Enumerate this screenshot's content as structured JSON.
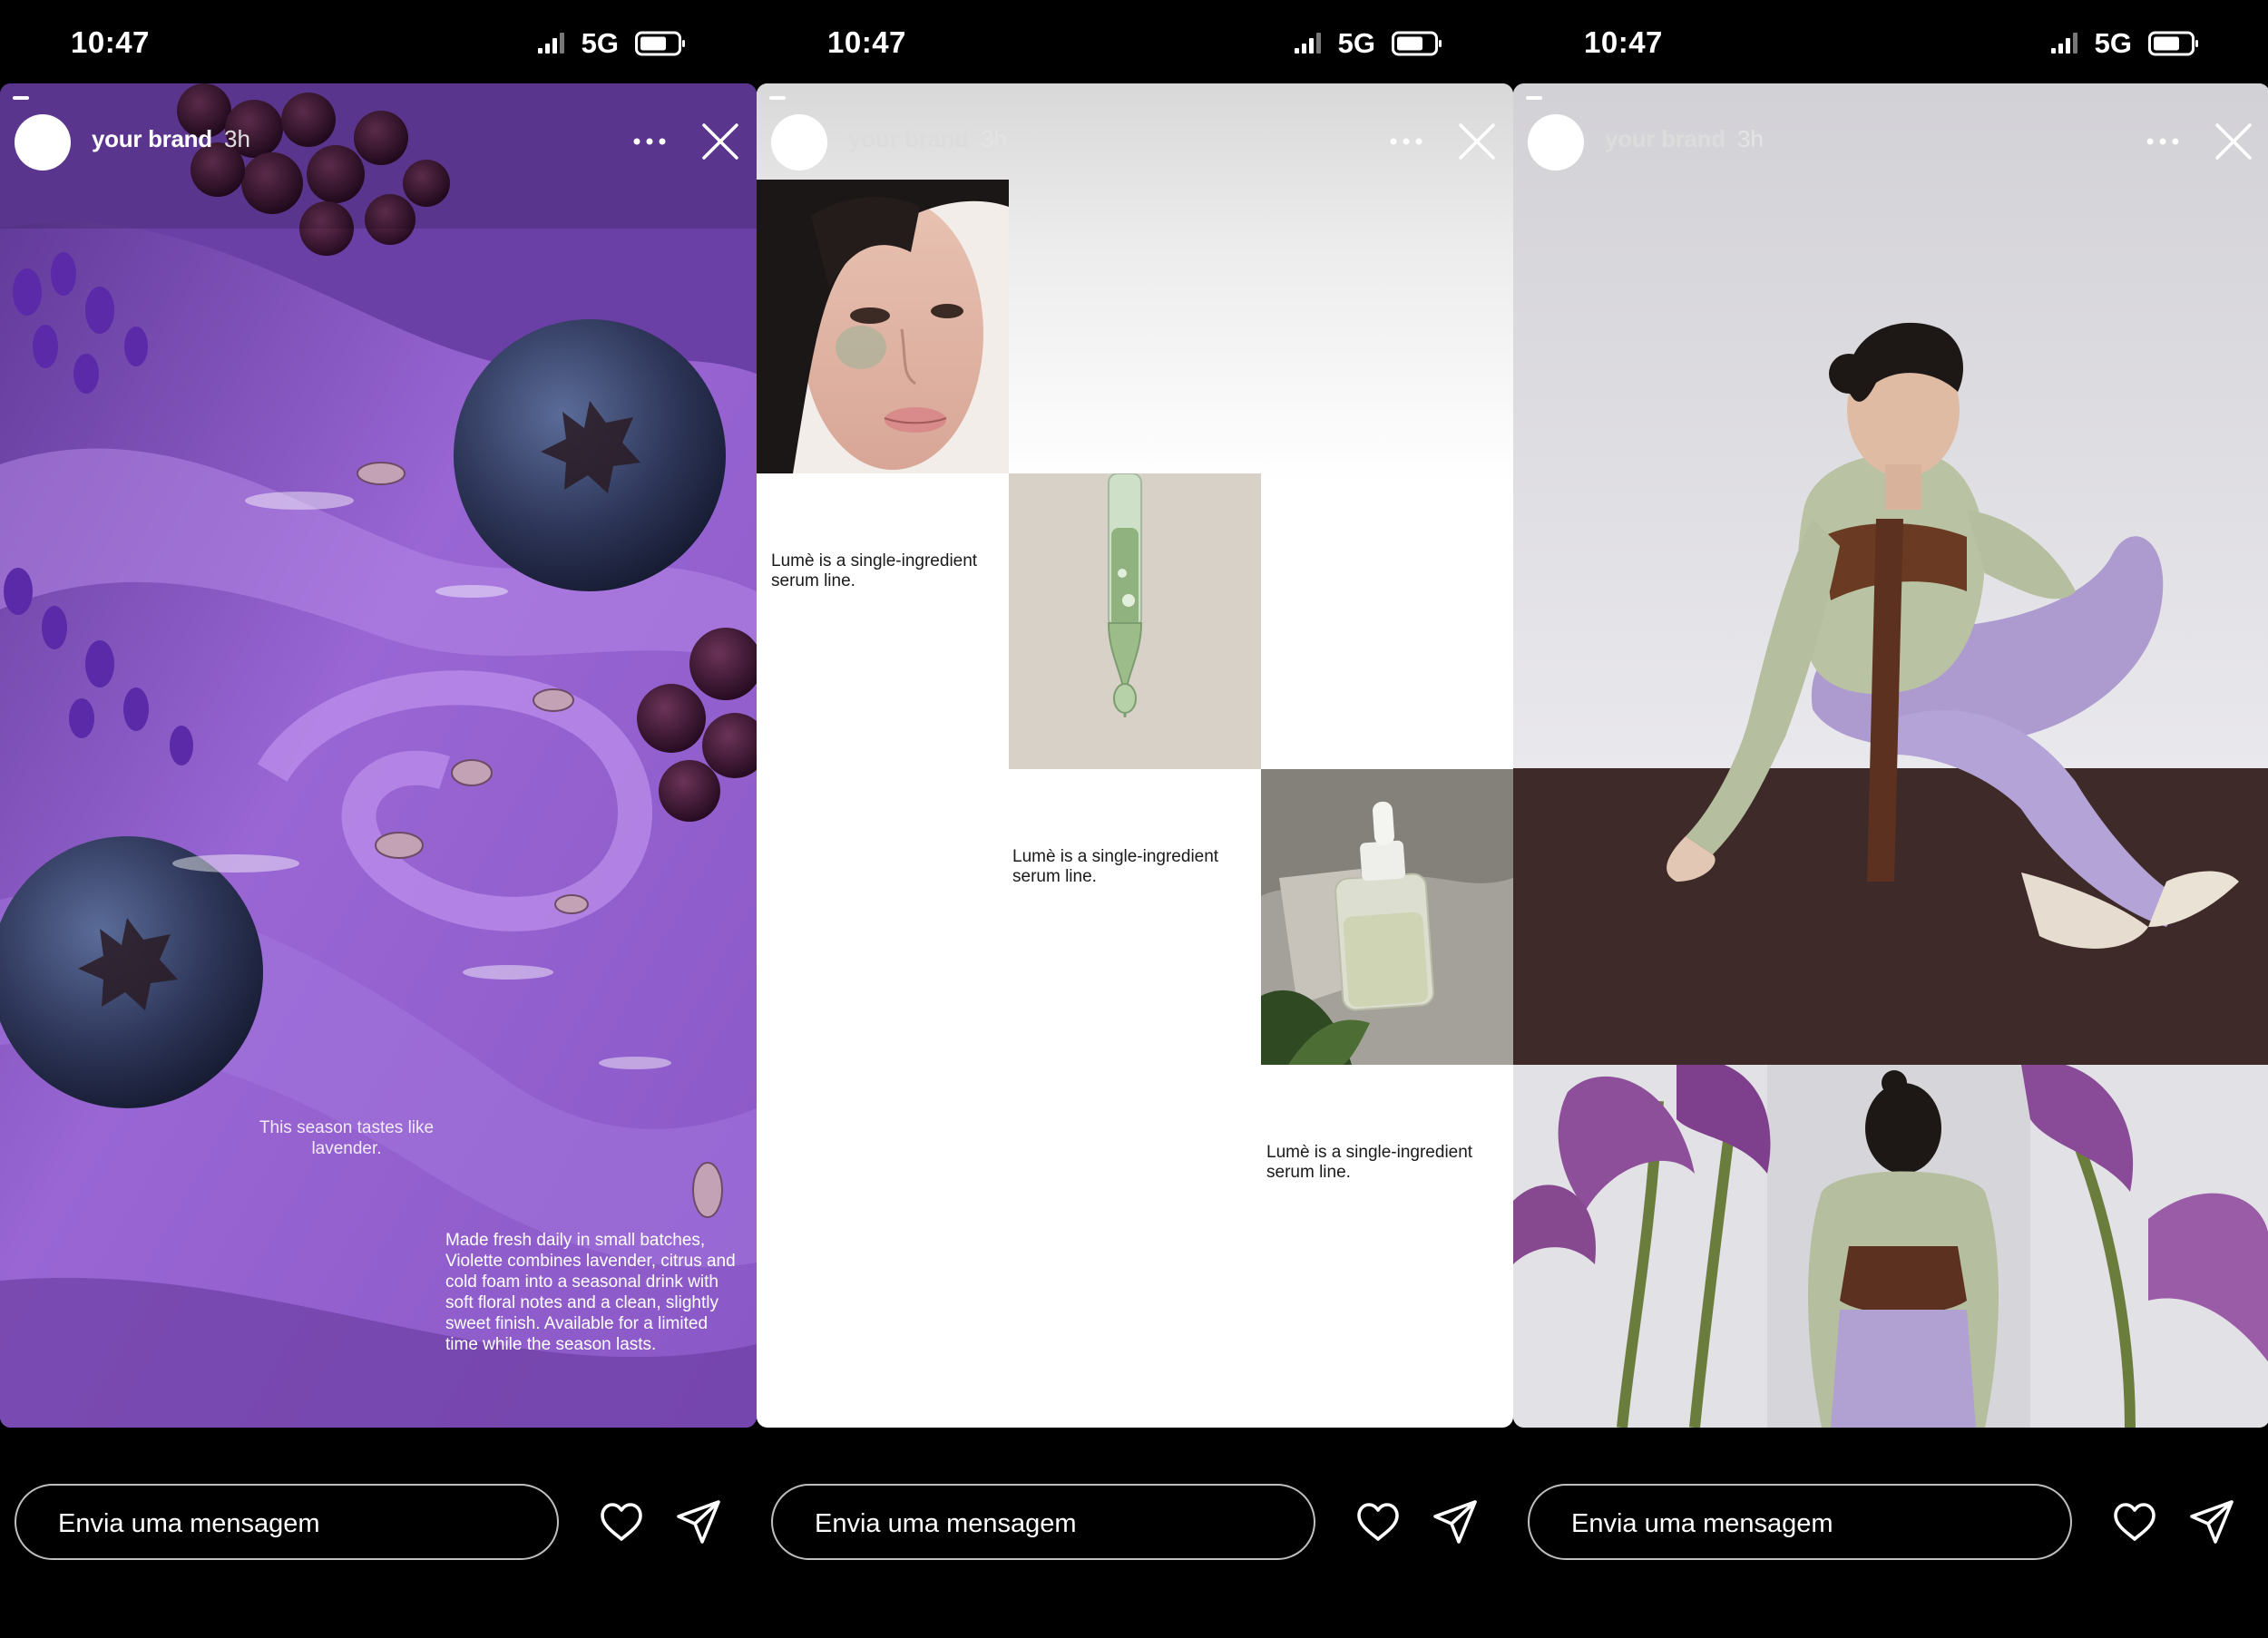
{
  "status_bar": {
    "time": "10:47",
    "network": "5G"
  },
  "stories": [
    {
      "username": "your brand",
      "time_ago": "3h",
      "headline": "This season tastes like lavender.",
      "body": "Made fresh daily in small batches, Violette combines lavender, citrus and cold foam into a seasonal drink with soft floral notes and a clean, slightly sweet finish. Available for a limited time while the season lasts."
    },
    {
      "username": "your brand",
      "time_ago": "3h",
      "captions": [
        "Lumè is a single-ingredient serum line.",
        "Lumè is a single-ingredient serum line.",
        "Lumè is a single-ingredient serum line."
      ]
    },
    {
      "username": "your brand",
      "time_ago": "3h"
    }
  ],
  "message_bar": {
    "placeholder": "Envia uma mensagem"
  },
  "icons": {
    "signal": "signal-icon",
    "battery": "battery-icon",
    "more": "more-icon",
    "close": "close-icon",
    "heart": "heart-icon",
    "send": "send-icon"
  }
}
